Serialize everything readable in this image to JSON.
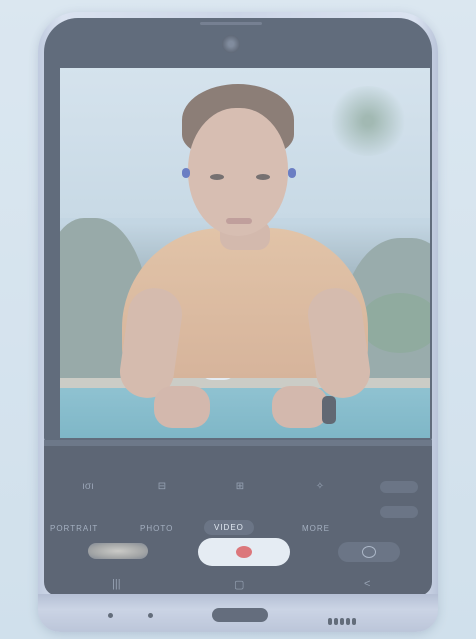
{
  "camera": {
    "quick_settings": {
      "flash_icon": "flash-icon",
      "timer_icon": "timer-icon",
      "ratio_icon": "aspect-ratio-icon",
      "effects_icon": "motion-icon",
      "settings_icon": "settings-pill-icon"
    },
    "modes": [
      "PORTRAIT",
      "PHOTO",
      "VIDEO",
      "MORE"
    ],
    "active_mode": "VIDEO",
    "shutter_color": "#e04545",
    "accent_color": "#3a4254"
  },
  "navbar": {
    "recents": "|||",
    "home": "▢",
    "back": "<"
  }
}
